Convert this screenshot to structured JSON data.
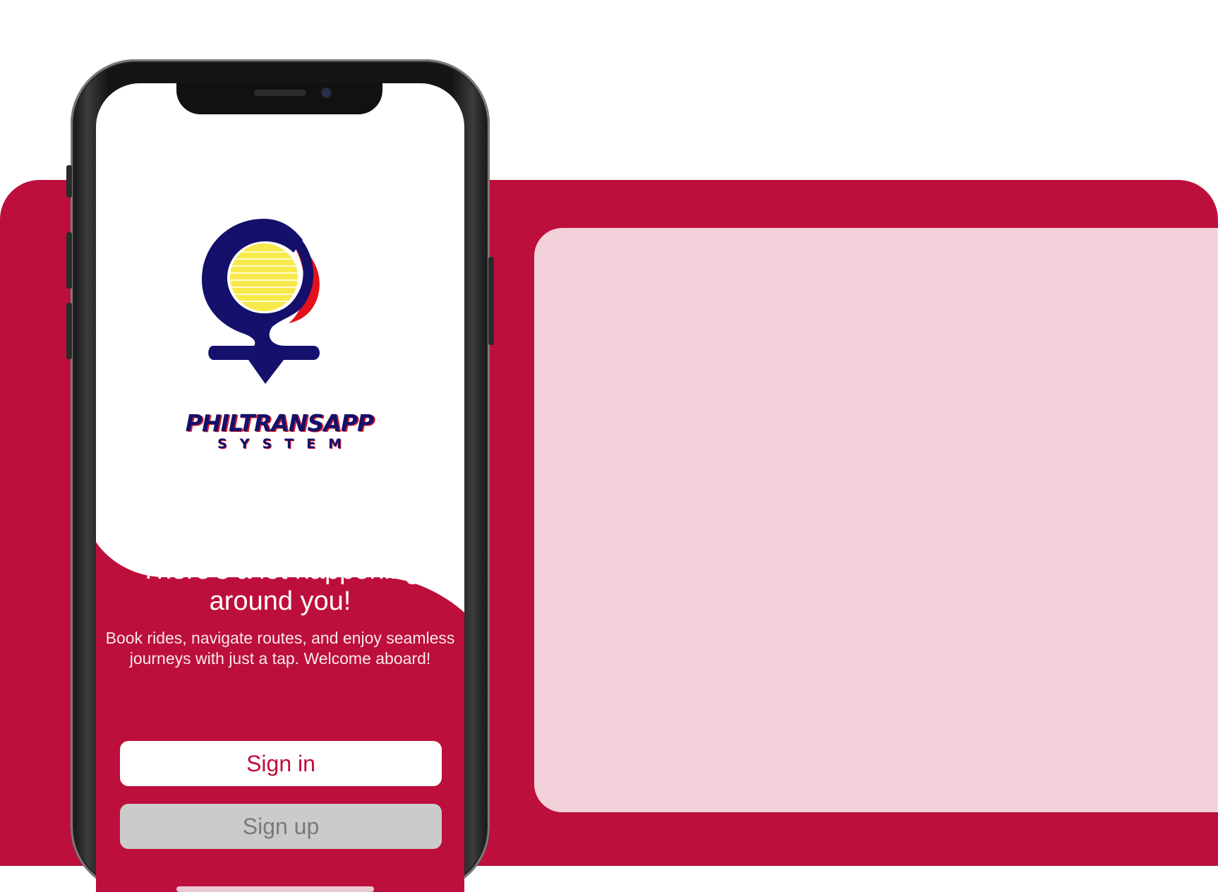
{
  "colors": {
    "brand_red": "#bd0f3c",
    "card_pink": "#f2d1da",
    "logo_navy": "#14106b",
    "logo_yellow": "#f7e94a",
    "logo_red": "#e4111a",
    "signup_grey": "#cbcbcb"
  },
  "icons": {
    "logo": "location-pin-logo-icon",
    "camera": "front-camera-icon"
  },
  "logo": {
    "brand_name": "PHILTRANSAPP",
    "brand_sub": "SYSTEM"
  },
  "welcome": {
    "headline": "There’s a lot happening around you!",
    "description": "Book rides, navigate routes, and enjoy seamless journeys with just a tap. Welcome aboard!"
  },
  "actions": {
    "sign_in_label": "Sign in",
    "sign_up_label": "Sign up"
  }
}
